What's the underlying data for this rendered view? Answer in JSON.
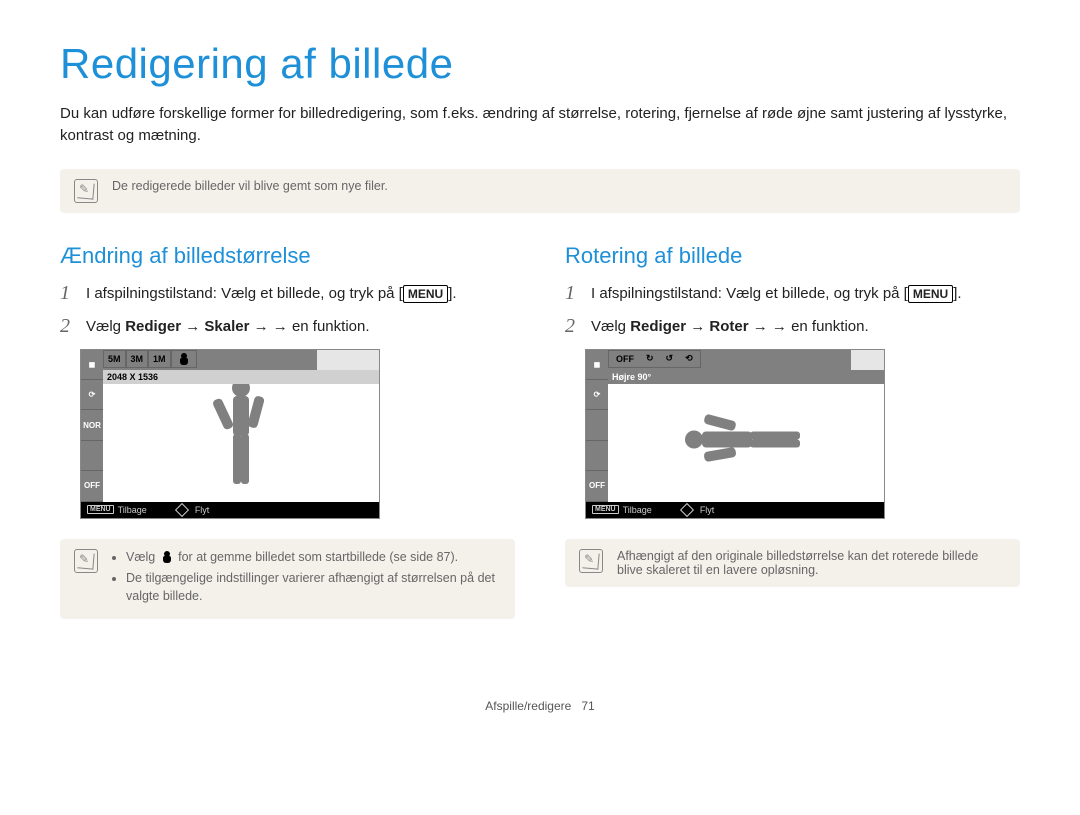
{
  "title": "Redigering af billede",
  "intro": "Du kan udføre forskellige former for billedredigering, som f.eks. ændring af størrelse, rotering, fjernelse af røde øjne samt justering af lysstyrke, kontrast og mætning.",
  "note_top": "De redigerede billeder vil blive gemt som nye filer.",
  "left": {
    "heading": "Ændring af billedstørrelse",
    "step1_prefix": "I afspilningstilstand: Vælg et billede, og tryk på [",
    "step1_menu": "MENU",
    "step1_suffix": "].",
    "step2_pre": "Vælg ",
    "step2_b1": "Rediger",
    "step2_arrow": " → ",
    "step2_b2": "Skaler",
    "step2_post": " → en funktion.",
    "screen": {
      "tabs": [
        "5M",
        "3M",
        "1M"
      ],
      "readout": "2048 X 1536",
      "left_slots": [
        "◼",
        "⟳",
        "NOR",
        "",
        "OFF"
      ],
      "bottom_menu": "MENU",
      "bottom_back": "Tilbage",
      "bottom_move": "Flyt"
    },
    "note_bullets": [
      "Vælg   for at gemme billedet som startbillede (se side 87).",
      "De tilgængelige indstillinger varierer afhængigt af størrelsen på det valgte billede."
    ],
    "note_b1_pre": "Vælg ",
    "note_b1_post": " for at gemme billedet som startbillede (se side 87)."
  },
  "right": {
    "heading": "Rotering af billede",
    "step1_prefix": "I afspilningstilstand: Vælg et billede, og tryk på [",
    "step1_menu": "MENU",
    "step1_suffix": "].",
    "step2_pre": "Vælg ",
    "step2_b1": "Rediger",
    "step2_arrow": " → ",
    "step2_b2": "Roter",
    "step2_post": " → en funktion.",
    "screen": {
      "readout": "Højre 90°",
      "rot_off": "OFF",
      "left_slots": [
        "◼",
        "⟳",
        "",
        "",
        "OFF"
      ],
      "bottom_menu": "MENU",
      "bottom_back": "Tilbage",
      "bottom_move": "Flyt"
    },
    "note_text": "Afhængigt af den originale billedstørrelse kan det roterede billede blive skaleret til en lavere opløsning."
  },
  "footer_section": "Afspille/redigere",
  "footer_page": "71"
}
